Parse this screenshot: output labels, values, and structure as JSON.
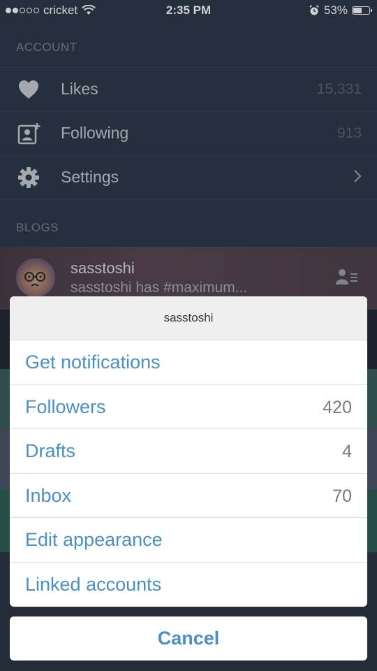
{
  "status_bar": {
    "carrier": "cricket",
    "time": "2:35 PM",
    "battery_percent": "53%",
    "signal_dots_filled": 2,
    "signal_dots_total": 5
  },
  "account": {
    "header": "ACCOUNT",
    "items": [
      {
        "label": "Likes",
        "count": "15,331",
        "icon": "heart-icon"
      },
      {
        "label": "Following",
        "count": "913",
        "icon": "add-contact-icon"
      },
      {
        "label": "Settings",
        "count": "",
        "icon": "gear-icon"
      }
    ]
  },
  "blogs": {
    "header": "BLOGS",
    "blog": {
      "name": "sasstoshi",
      "subtitle": "sasstoshi has #maximum..."
    }
  },
  "sheet": {
    "title": "sasstoshi",
    "items": [
      {
        "label": "Get notifications",
        "value": ""
      },
      {
        "label": "Followers",
        "value": "420"
      },
      {
        "label": "Drafts",
        "value": "4"
      },
      {
        "label": "Inbox",
        "value": "70"
      },
      {
        "label": "Edit appearance",
        "value": ""
      },
      {
        "label": "Linked accounts",
        "value": ""
      }
    ],
    "cancel_label": "Cancel"
  },
  "colors": {
    "background": "#2f3a4b",
    "accent": "#4a90c4",
    "sheet_bg": "#ffffff"
  }
}
